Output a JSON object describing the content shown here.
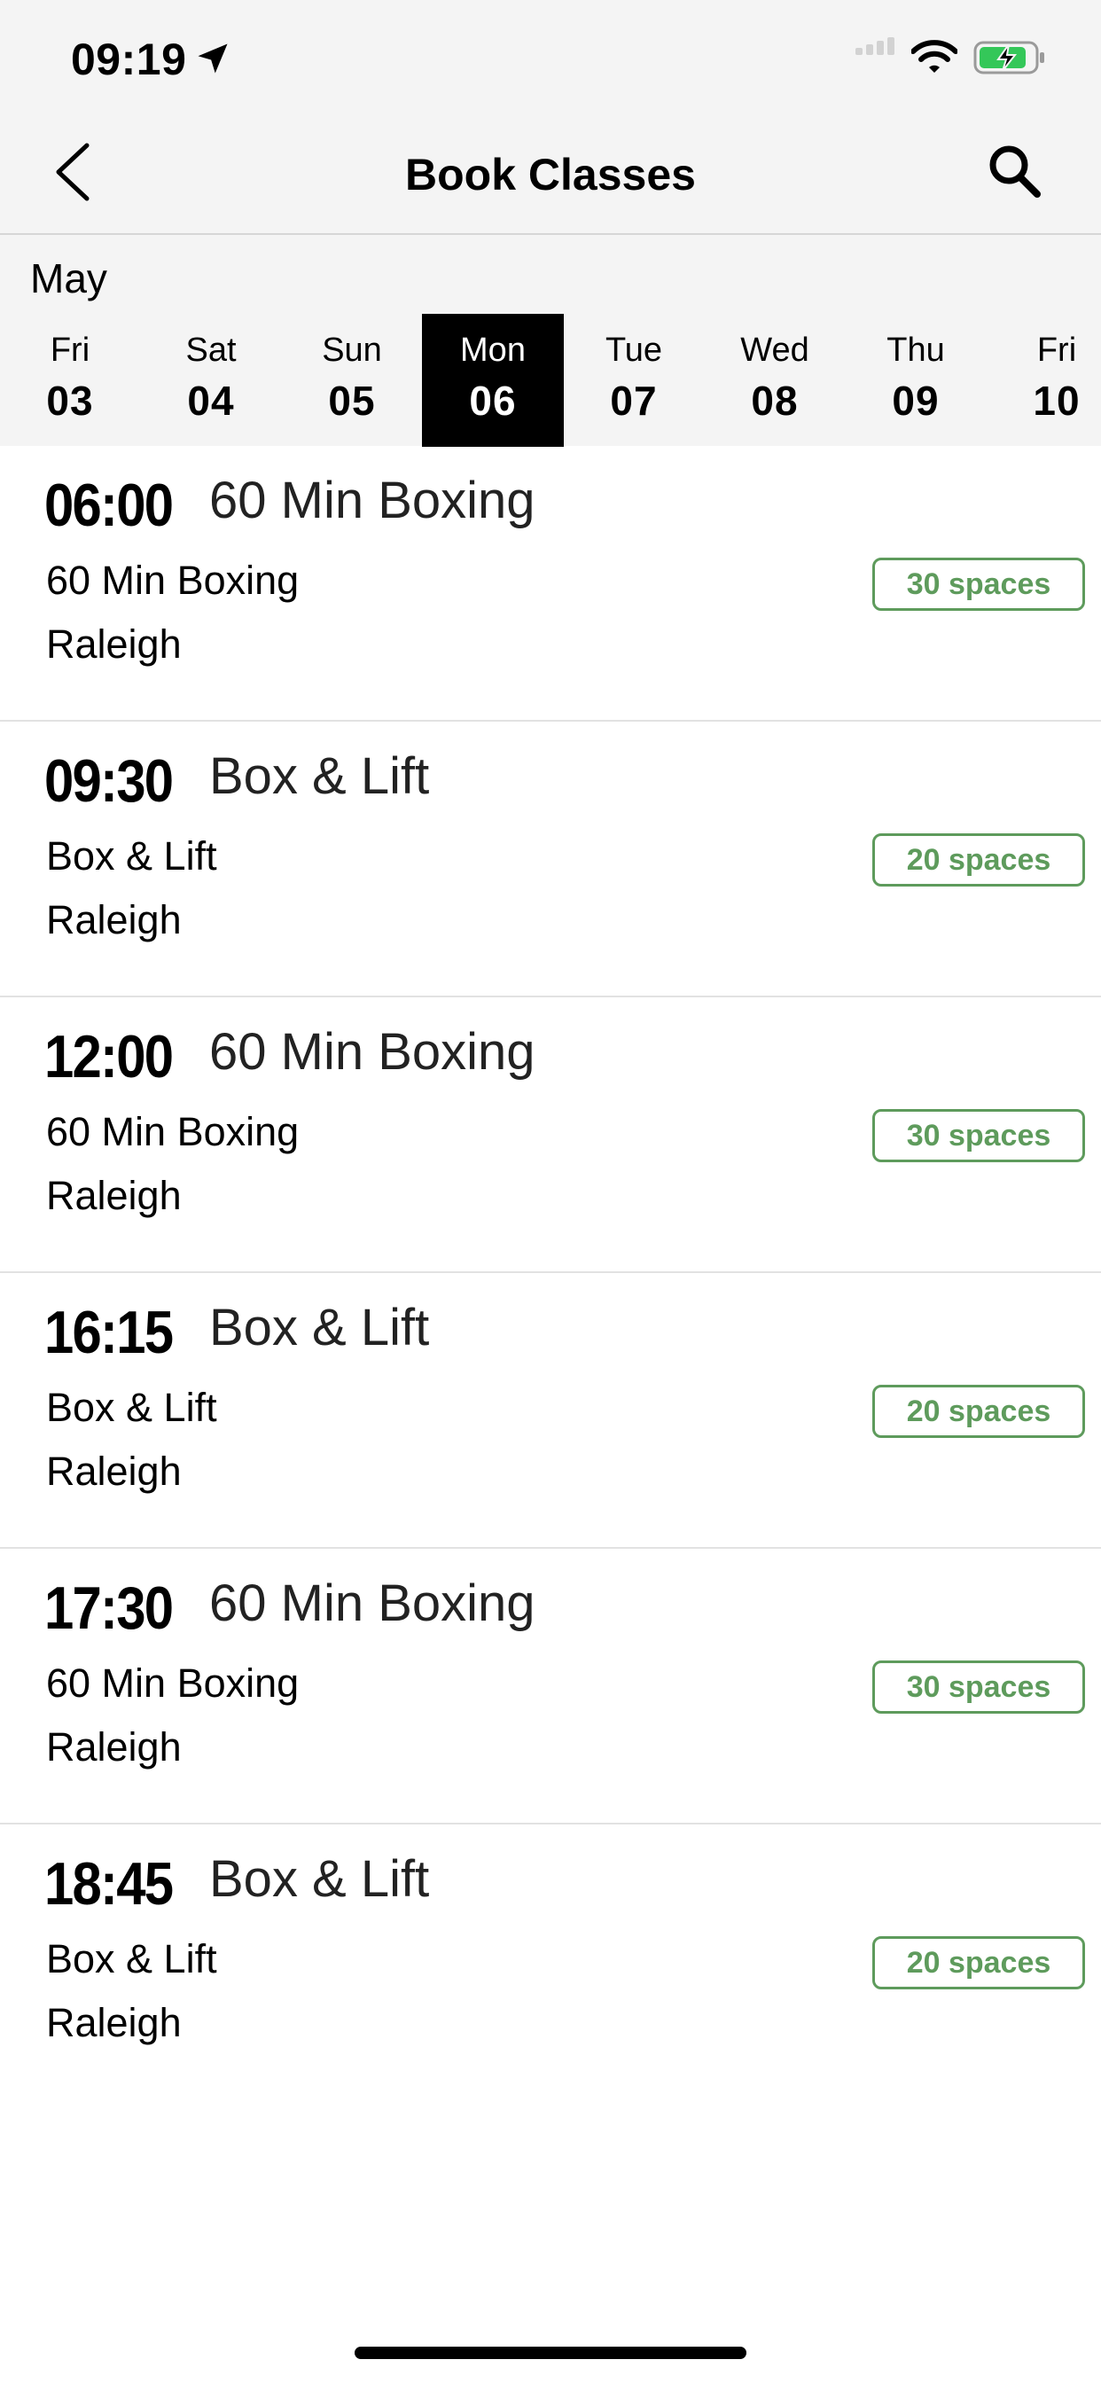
{
  "status_bar": {
    "time": "09:19",
    "icons": [
      "location-arrow-icon",
      "signal-icon",
      "wifi-icon",
      "battery-charging-icon"
    ],
    "battery_color": "#34c759"
  },
  "nav": {
    "title": "Book Classes",
    "back_icon": "chevron-left-icon",
    "search_icon": "search-icon"
  },
  "calendar": {
    "month": "May",
    "days": [
      {
        "name": "Fri",
        "num": "03",
        "selected": false
      },
      {
        "name": "Sat",
        "num": "04",
        "selected": false
      },
      {
        "name": "Sun",
        "num": "05",
        "selected": false
      },
      {
        "name": "Mon",
        "num": "06",
        "selected": true
      },
      {
        "name": "Tue",
        "num": "07",
        "selected": false
      },
      {
        "name": "Wed",
        "num": "08",
        "selected": false
      },
      {
        "name": "Thu",
        "num": "09",
        "selected": false
      },
      {
        "name": "Fri",
        "num": "10",
        "selected": false
      }
    ]
  },
  "classes": [
    {
      "time": "06:00",
      "title": "60 Min Boxing",
      "subtitle": "60 Min Boxing",
      "location": "Raleigh",
      "spaces": "30 spaces"
    },
    {
      "time": "09:30",
      "title": "Box & Lift",
      "subtitle": "Box & Lift",
      "location": "Raleigh",
      "spaces": "20 spaces"
    },
    {
      "time": "12:00",
      "title": "60 Min Boxing",
      "subtitle": "60 Min Boxing",
      "location": "Raleigh",
      "spaces": "30 spaces"
    },
    {
      "time": "16:15",
      "title": "Box & Lift",
      "subtitle": "Box & Lift",
      "location": "Raleigh",
      "spaces": "20 spaces"
    },
    {
      "time": "17:30",
      "title": "60 Min Boxing",
      "subtitle": "60 Min Boxing",
      "location": "Raleigh",
      "spaces": "30 spaces"
    },
    {
      "time": "18:45",
      "title": "Box & Lift",
      "subtitle": "Box & Lift",
      "location": "Raleigh",
      "spaces": "20 spaces"
    }
  ],
  "colors": {
    "accent_green": "#5e9b5c",
    "selected_day_bg": "#000000",
    "header_bg": "#f4f4f4"
  }
}
